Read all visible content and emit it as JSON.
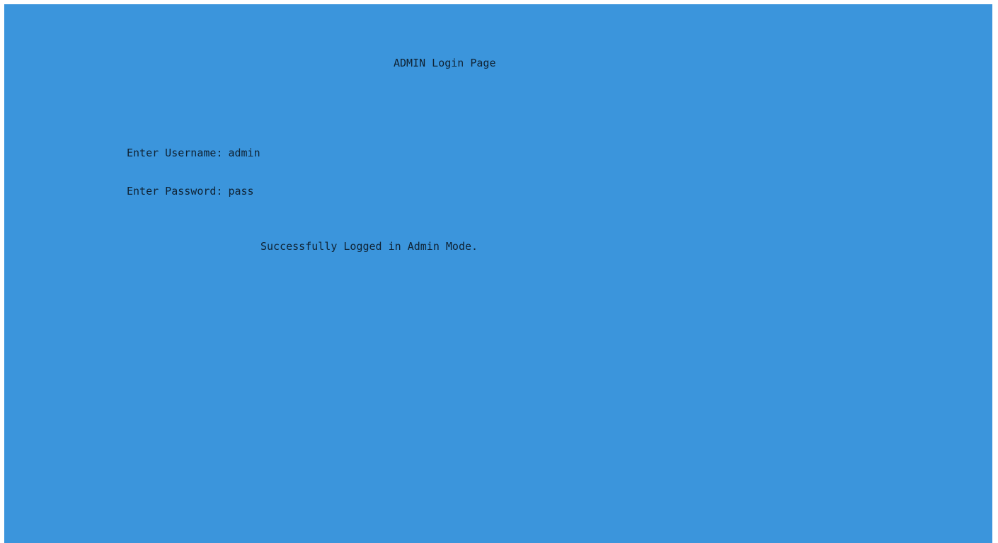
{
  "console": {
    "background_color": "#3b95dc",
    "text_color": "#0f2233",
    "title": "ADMIN Login Page",
    "username_prompt": "Enter Username:",
    "username_value": "admin",
    "password_prompt": "Enter Password:",
    "password_value": "pass",
    "status_message": "Successfully Logged in Admin Mode."
  }
}
